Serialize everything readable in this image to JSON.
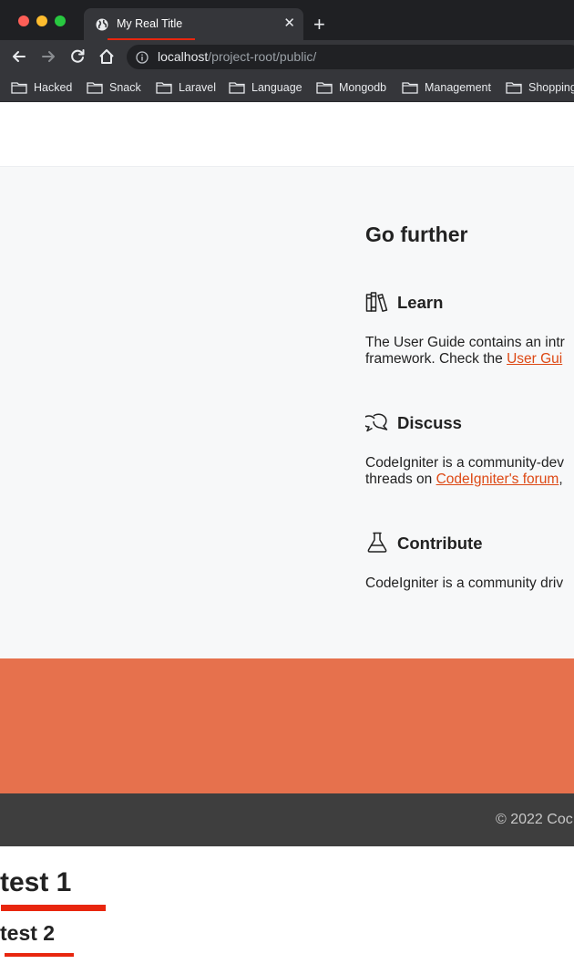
{
  "browser": {
    "tab_title": "My Real Title",
    "tab_close": "✕",
    "new_tab": "+",
    "url_host": "localhost",
    "url_path": "/project-root/public/",
    "bookmarks": [
      "Hacked",
      "Snack",
      "Laravel",
      "Language",
      "Mongodb",
      "Management",
      "Shopping"
    ]
  },
  "go_further": {
    "title": "Go further",
    "learn": {
      "title": "Learn",
      "text_1": "The User Guide contains an intr",
      "text_2_prefix": "framework. Check the ",
      "link": "User Gui"
    },
    "discuss": {
      "title": "Discuss",
      "text_1": "CodeIgniter is a community-dev",
      "text_2_prefix": "threads on ",
      "link": "CodeIgniter's forum",
      "text_2_suffix": ","
    },
    "contribute": {
      "title": "Contribute",
      "text_1": "CodeIgniter is a community driv"
    }
  },
  "footer": {
    "copyright": "© 2022 Coc"
  },
  "tests": {
    "test1": "test 1",
    "test2": "test 2"
  },
  "colors": {
    "accent_red": "#e8260e",
    "link": "#dd4814",
    "orange_band": "#e6714d",
    "footer_bg": "#3e3e3e"
  }
}
